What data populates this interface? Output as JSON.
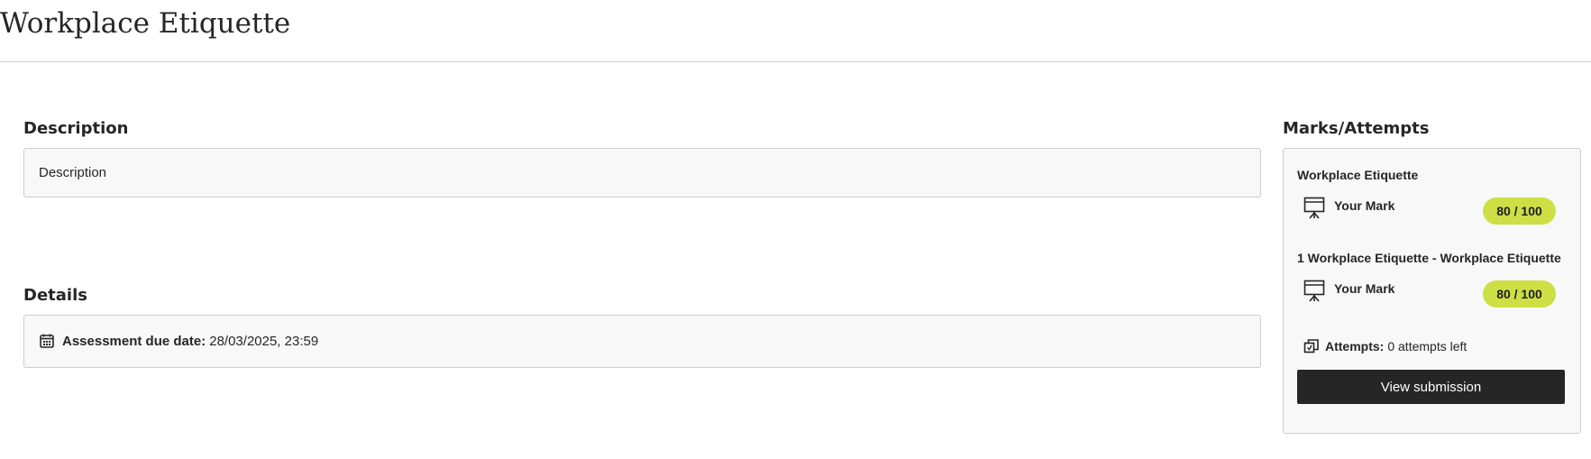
{
  "page": {
    "title": "Workplace Etiquette"
  },
  "description_section": {
    "heading": "Description",
    "text": "Description"
  },
  "details_section": {
    "heading": "Details",
    "due_label": "Assessment due date:",
    "due_value": "28/03/2025, 23:59",
    "icon": "calendar-icon"
  },
  "marks_section": {
    "heading": "Marks/Attempts",
    "items": [
      {
        "title": "Workplace Etiquette",
        "mark_label": "Your Mark",
        "mark_value": "80 / 100",
        "icon": "presentation-board-icon"
      },
      {
        "title": "1 Workplace Etiquette - Workplace Etiquette",
        "mark_label": "Your Mark",
        "mark_value": "80 / 100",
        "icon": "presentation-board-icon"
      }
    ],
    "attempts_label": "Attempts:",
    "attempts_value": "0 attempts left",
    "attempts_icon": "attempts-icon",
    "view_button_label": "View submission"
  },
  "colors": {
    "badge_background": "#cddf45",
    "button_background": "#262626",
    "panel_background": "#f8f8f8",
    "border": "#cdcdcd"
  }
}
